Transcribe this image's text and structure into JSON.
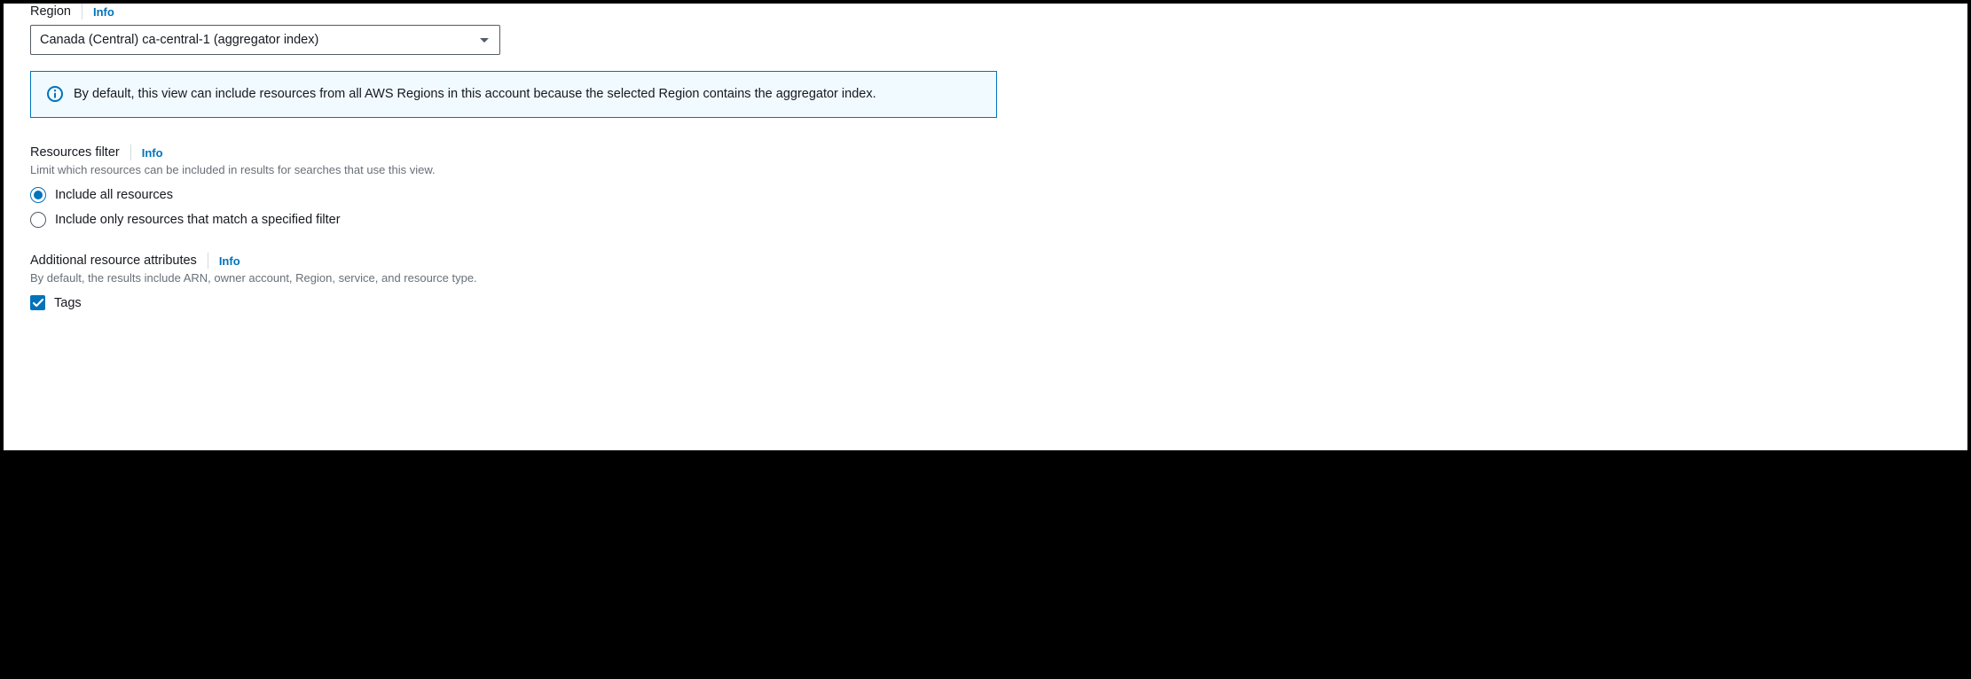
{
  "region": {
    "label": "Region",
    "info": "Info",
    "selected": "Canada (Central) ca-central-1 (aggregator index)"
  },
  "alert": {
    "text": "By default, this view can include resources from all AWS Regions in this account because the selected Region contains the aggregator index."
  },
  "resources_filter": {
    "title": "Resources filter",
    "info": "Info",
    "description": "Limit which resources can be included in results for searches that use this view.",
    "options": {
      "all": "Include all resources",
      "match": "Include only resources that match a specified filter"
    }
  },
  "additional_attributes": {
    "title": "Additional resource attributes",
    "info": "Info",
    "description": "By default, the results include ARN, owner account, Region, service, and resource type.",
    "tags_label": "Tags"
  }
}
